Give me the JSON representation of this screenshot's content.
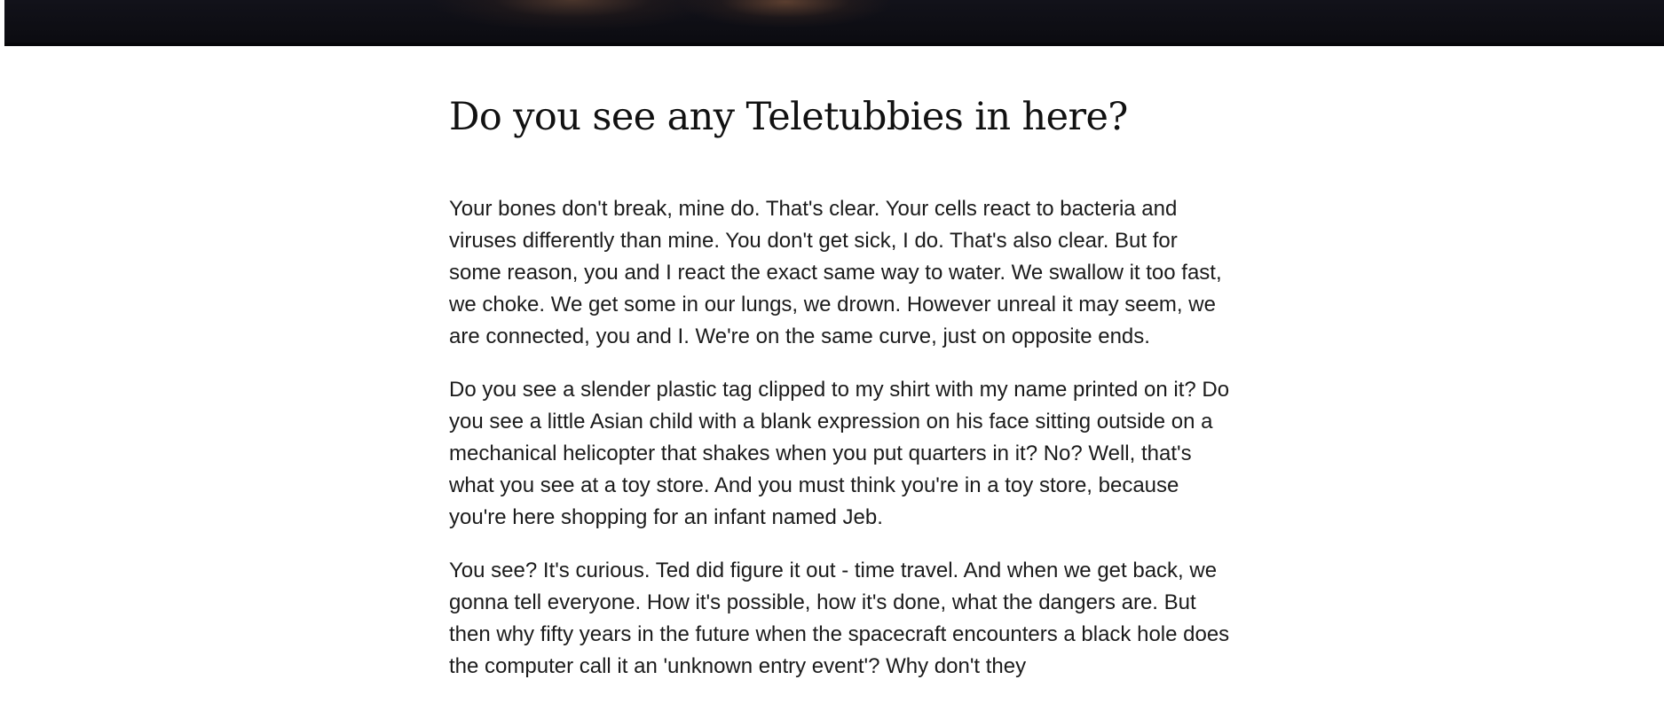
{
  "article": {
    "title": "Do you see any Teletubbies in here?",
    "paragraphs": [
      "Your bones don't break, mine do. That's clear. Your cells react to bacteria and viruses differently than mine. You don't get sick, I do. That's also clear. But for some reason, you and I react the exact same way to water. We swallow it too fast, we choke. We get some in our lungs, we drown. However unreal it may seem, we are connected, you and I. We're on the same curve, just on opposite ends.",
      "Do you see a slender plastic tag clipped to my shirt with my name printed on it? Do you see a little Asian child with a blank expression on his face sitting outside on a mechanical helicopter that shakes when you put quarters in it? No? Well, that's what you see at a toy store. And you must think you're in a toy store, because you're here shopping for an infant named Jeb.",
      "You see? It's curious. Ted did figure it out - time travel. And when we get back, we gonna tell everyone. How it's possible, how it's done, what the dangers are. But then why fifty years in the future when the spacecraft encounters a black hole does the computer call it an 'unknown entry event'? Why don't they"
    ]
  }
}
